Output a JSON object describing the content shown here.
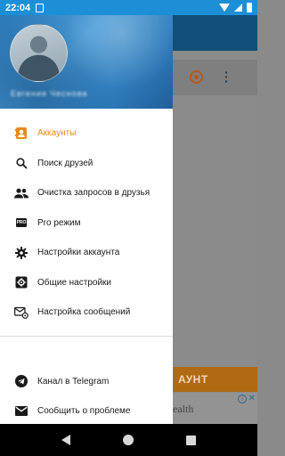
{
  "status_bar": {
    "time": "22:04"
  },
  "drawer": {
    "username": "Евгения Чеснова",
    "menu_top": [
      {
        "label": "Аккаунты",
        "icon": "contacts-icon",
        "active": true
      },
      {
        "label": "Поиск друзей",
        "icon": "search-icon"
      },
      {
        "label": "Очистка запросов в друзья",
        "icon": "people-icon"
      },
      {
        "label": "Pro режим",
        "icon": "pro-icon"
      },
      {
        "label": "Настройки аккаунта",
        "icon": "gear-icon"
      },
      {
        "label": "Общие настройки",
        "icon": "settings-box-icon"
      },
      {
        "label": "Настройка сообщений",
        "icon": "mail-settings-icon"
      }
    ],
    "menu_bottom": [
      {
        "label": "Канал в Telegram",
        "icon": "telegram-icon"
      },
      {
        "label": "Сообщить о проблеме",
        "icon": "mail-icon"
      }
    ]
  },
  "background_app": {
    "button_fragment": "АУНТ",
    "ad_fragment": "ealth"
  },
  "pro_badge": "PRO",
  "colors": {
    "accent": "#e88a14",
    "status_bar": "#1d8fd6"
  }
}
